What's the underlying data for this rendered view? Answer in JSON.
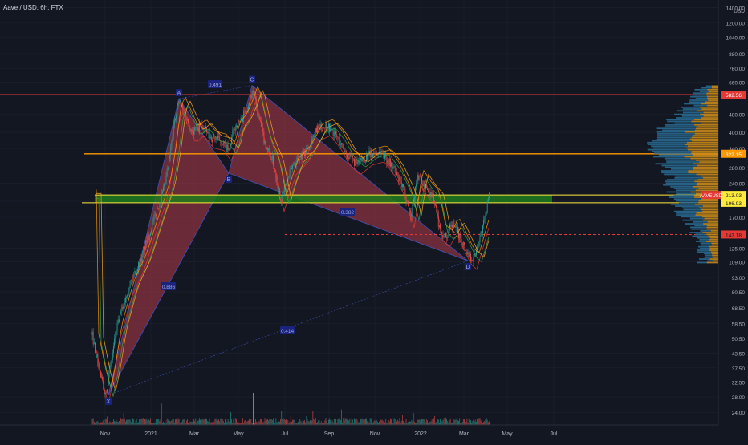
{
  "header": {
    "symbol": "Aave / USD, 6h, FTX",
    "currency": "USD"
  },
  "colors": {
    "background": "#131722",
    "candle_up": "#26a69a",
    "candle_down": "#ef5350",
    "pattern_fill": "#b23a48",
    "zone_fill": "#1e7a1e",
    "red_line": "#e53935",
    "orange_line": "#ff9800",
    "yellow_line": "#ffeb3b",
    "label_box": "#1a237e",
    "profile_orange": "#c98a1a",
    "profile_blue": "#2a6f97"
  },
  "chart_data": {
    "type": "candlestick",
    "title": "Aave / USD, 6h, FTX",
    "y_scale": "log",
    "ylim": [
      22,
      1450
    ],
    "x_ticks": [
      "Nov",
      "2021",
      "Mar",
      "May",
      "Jul",
      "Sep",
      "Nov",
      "2022",
      "Mar",
      "May",
      "Jul"
    ],
    "y_ticks": [
      1400,
      1200,
      1040,
      880,
      760,
      660,
      580,
      480,
      400,
      340,
      280,
      240,
      200,
      170,
      145,
      125,
      109,
      93,
      80.5,
      68.5,
      58.5,
      50.5,
      43.5,
      37.5,
      32.5,
      28,
      24
    ],
    "price_levels": [
      {
        "label": "582.56",
        "value": 582.56,
        "color": "#e53935"
      },
      {
        "label": "322.15",
        "value": 322.15,
        "color": "#ff9800"
      },
      {
        "label": "213.03",
        "value": 213.03,
        "color": "#ffeb3b"
      },
      {
        "label": "196.93",
        "value": 196.93,
        "color": "#ffeb3b"
      },
      {
        "label": "143.18",
        "value": 143.18,
        "color": "#e53935"
      }
    ],
    "current_price": {
      "label": "AAVEUSD",
      "value": 213.03
    },
    "harmonic_points": [
      {
        "label": "X",
        "value": 28.5
      },
      {
        "label": "A",
        "value": 560
      },
      {
        "label": "B",
        "value": 265
      },
      {
        "label": "C",
        "value": 640
      },
      {
        "label": "D",
        "value": 110
      }
    ],
    "ratio_labels": [
      "0.491",
      "0.886",
      "0.382",
      "0.414"
    ]
  }
}
